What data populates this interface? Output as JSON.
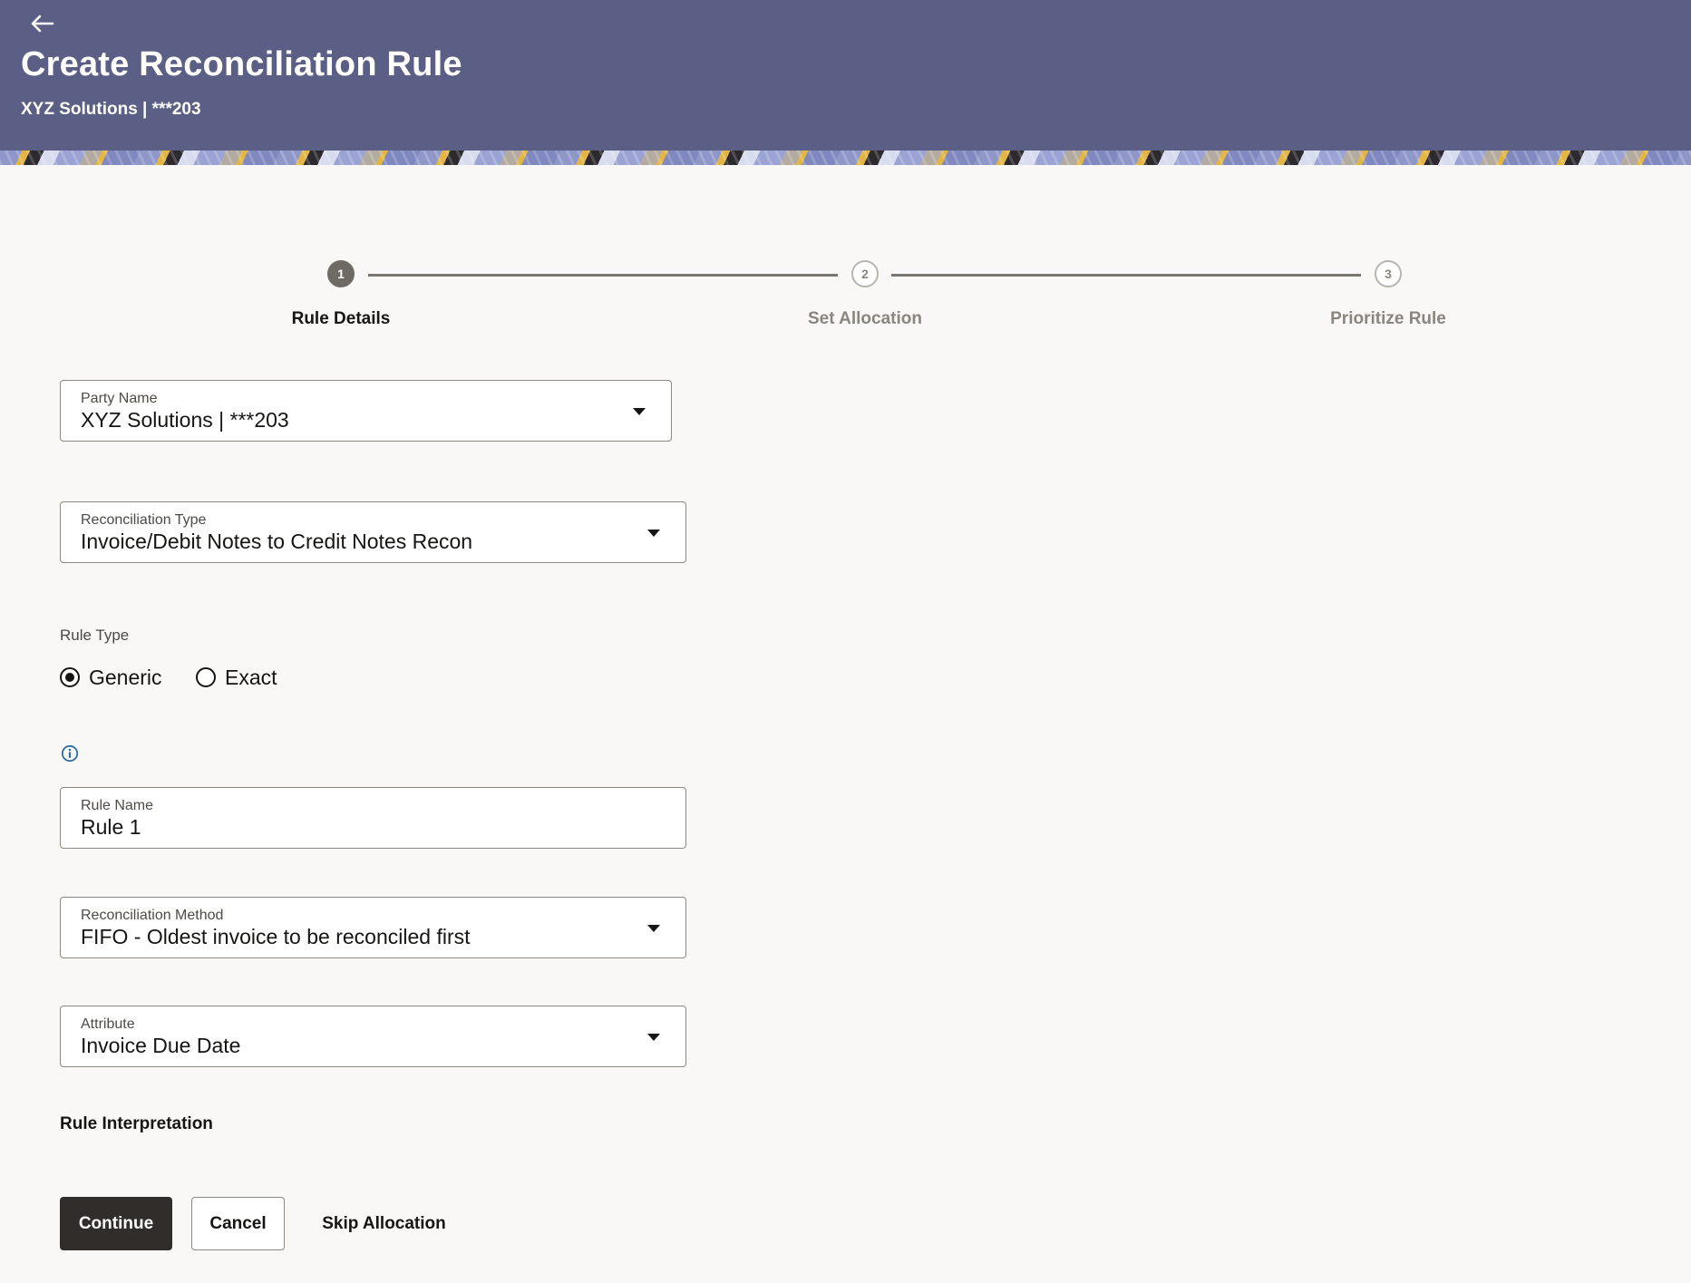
{
  "header": {
    "title": "Create Reconciliation Rule",
    "subtitle": "XYZ Solutions | ***203",
    "background_color": "#5b5f85"
  },
  "stepper": {
    "steps": [
      {
        "number": "1",
        "label": "Rule Details",
        "state": "active"
      },
      {
        "number": "2",
        "label": "Set Allocation",
        "state": "pending"
      },
      {
        "number": "3",
        "label": "Prioritize Rule",
        "state": "pending"
      }
    ]
  },
  "form": {
    "party_name": {
      "label": "Party Name",
      "value": "XYZ Solutions | ***203"
    },
    "reconciliation_type": {
      "label": "Reconciliation Type",
      "value": "Invoice/Debit Notes to Credit Notes Recon"
    },
    "rule_type": {
      "label": "Rule Type",
      "options": [
        {
          "label": "Generic",
          "checked": true
        },
        {
          "label": "Exact",
          "checked": false
        }
      ]
    },
    "rule_name": {
      "label": "Rule Name",
      "value": "Rule 1"
    },
    "reconciliation_method": {
      "label": "Reconciliation Method",
      "value": "FIFO - Oldest invoice to be reconciled first"
    },
    "attribute": {
      "label": "Attribute",
      "value": "Invoice Due Date"
    },
    "rule_interpretation_label": "Rule Interpretation"
  },
  "actions": {
    "continue_label": "Continue",
    "cancel_label": "Cancel",
    "skip_label": "Skip Allocation"
  },
  "icons": {
    "back": "back-arrow-icon",
    "info": "info-icon",
    "dropdown": "chevron-down-icon"
  },
  "colors": {
    "primary_button": "#312d2a",
    "info_icon": "#2b6ea4",
    "page_background": "#f9f8f6"
  }
}
